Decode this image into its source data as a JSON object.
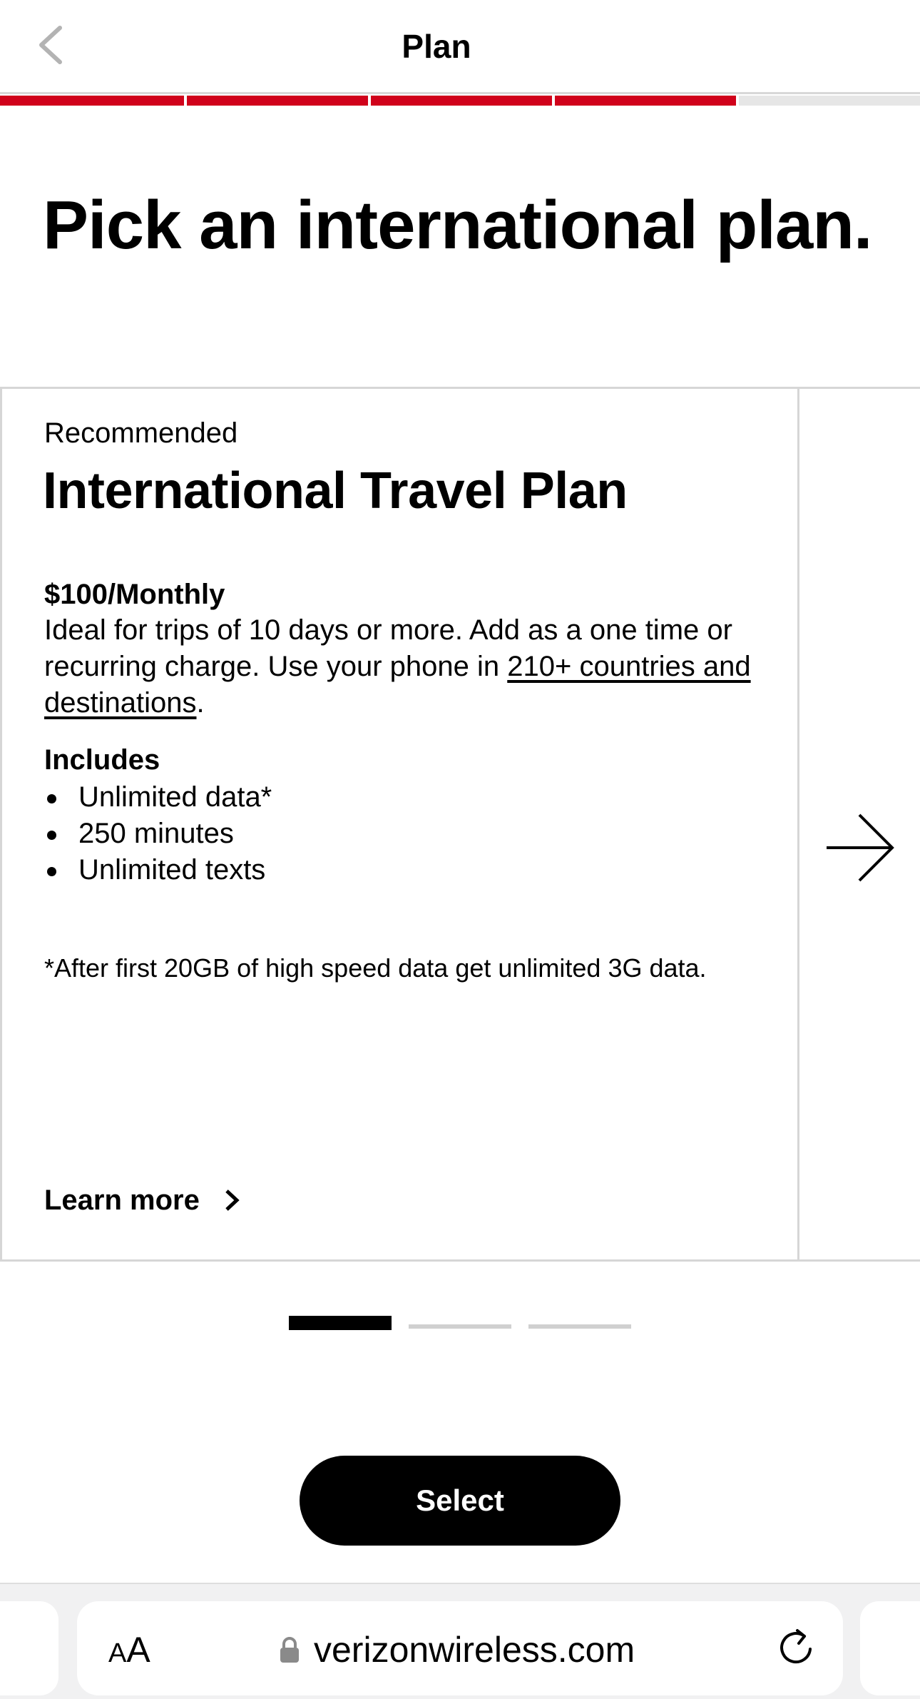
{
  "header": {
    "title": "Plan",
    "back_icon": "chevron-left-icon"
  },
  "progress": {
    "steps_total": 5,
    "steps_completed": 4,
    "color": "#d0021b"
  },
  "page": {
    "title": "Pick an international plan."
  },
  "card": {
    "tag": "Recommended",
    "name": "International Travel Plan",
    "price": "$100/Monthly",
    "description_prefix": "Ideal for trips of 10 days or more. Add as a one time or recurring charge. Use your phone in ",
    "description_link": "210+ countries and destinations",
    "description_suffix": ".",
    "includes_heading": "Includes",
    "includes": [
      "Unlimited data*",
      "250 minutes",
      "Unlimited texts"
    ],
    "footnote": "*After first 20GB of high speed data get unlimited 3G data.",
    "learn_more": "Learn more"
  },
  "carousel": {
    "pages": 3,
    "current": 1,
    "next_icon": "arrow-right-icon"
  },
  "actions": {
    "select_label": "Select"
  },
  "browser": {
    "aa_small": "A",
    "aa_large": "A",
    "url": "verizonwireless.com",
    "lock_icon": "lock-icon",
    "reload_icon": "reload-icon"
  }
}
